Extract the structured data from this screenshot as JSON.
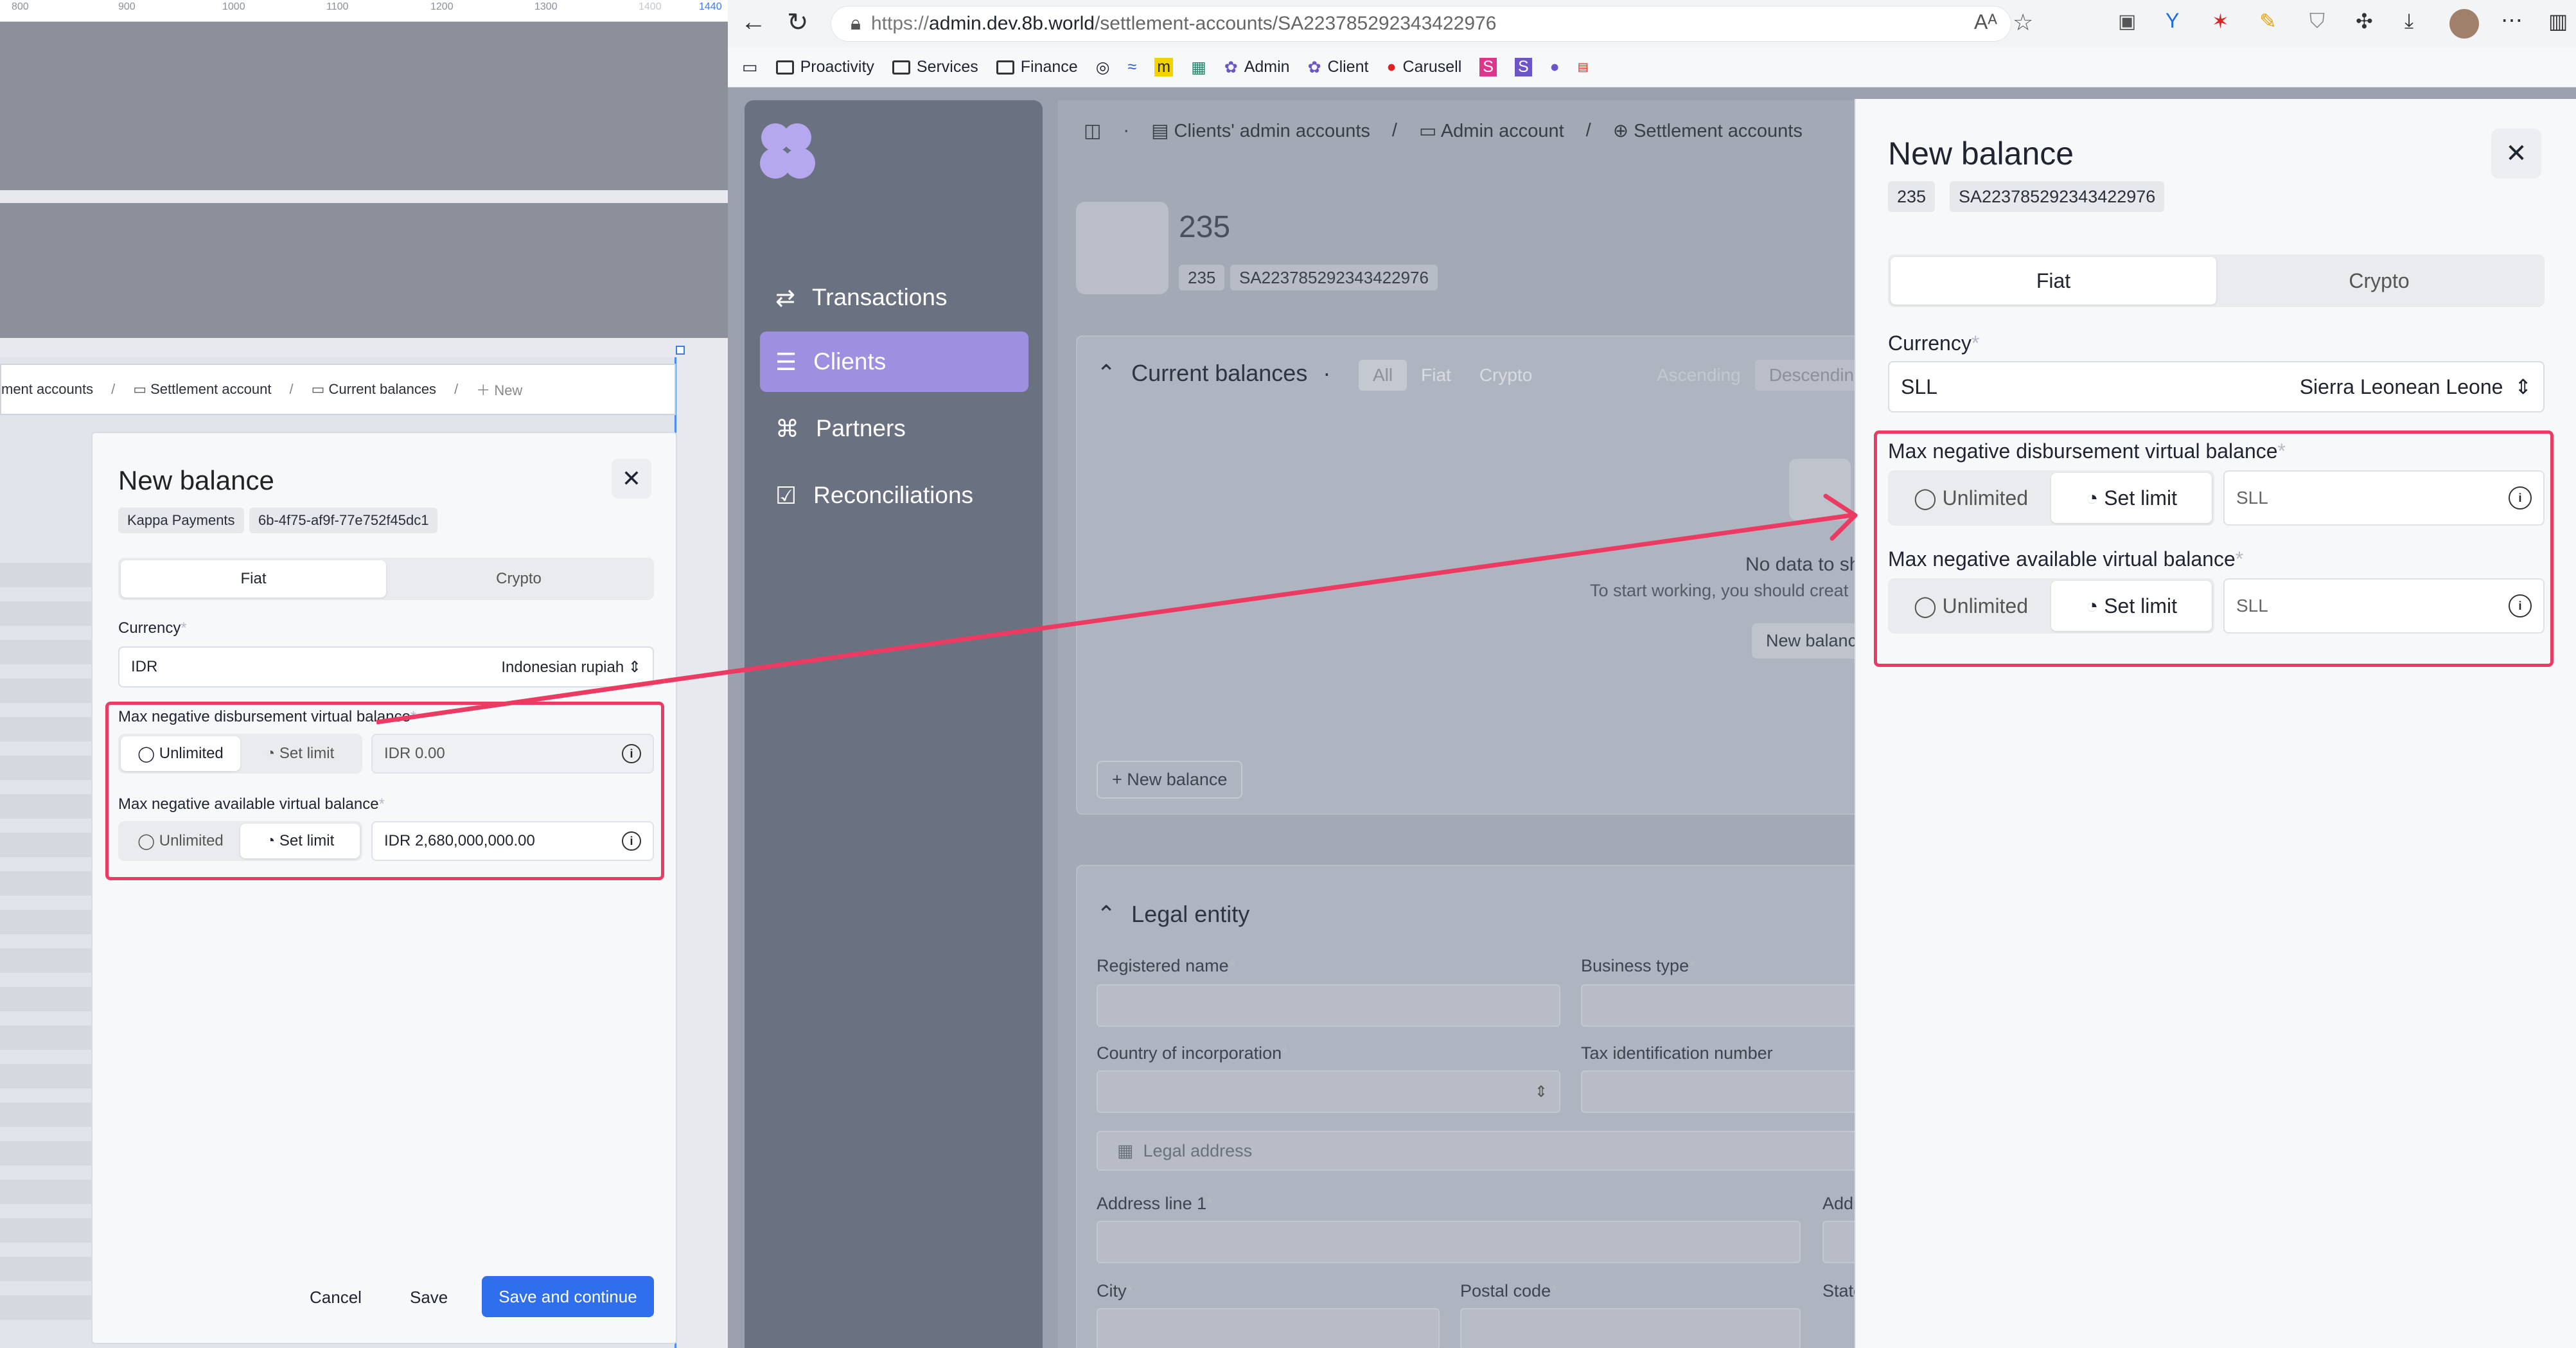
{
  "figma": {
    "ruler_ticks": [
      "800",
      "900",
      "1000",
      "1100",
      "1200",
      "1300",
      "1400",
      "1440"
    ],
    "breadcrumb": [
      "ment accounts",
      "Settlement account",
      "Current balances",
      "New"
    ],
    "modal": {
      "title": "New balance",
      "chip1": "Kappa Payments",
      "chip2": "6b-4f75-af9f-77e752f45dc1",
      "tab_fiat": "Fiat",
      "tab_crypto": "Crypto",
      "currency_label": "Currency",
      "currency_code": "IDR",
      "currency_name": "Indonesian rupiah",
      "disb_label": "Max negative disbursement virtual balance",
      "unlimited": "Unlimited",
      "set_limit": "Set limit",
      "disb_value": "IDR  0.00",
      "avail_label": "Max negative available virtual balance",
      "avail_value": "IDR  2,680,000,000.00",
      "cancel": "Cancel",
      "save": "Save",
      "save_continue": "Save and continue"
    }
  },
  "browser": {
    "url_prefix": "https://",
    "url_host": "admin.dev.8b.world",
    "url_path": "/settlement-accounts/SA223785292343422976",
    "bookmarks": [
      "Proactivity",
      "Services",
      "Finance",
      "Admin",
      "Client",
      "Carusell"
    ]
  },
  "sidebar": {
    "items": [
      "Transactions",
      "Clients",
      "Partners",
      "Reconciliations"
    ]
  },
  "main": {
    "crumbs": [
      "Clients' admin accounts",
      "Admin account",
      "Settlement accounts"
    ],
    "title": "235",
    "chip1": "235",
    "chip2": "SA223785292343422976",
    "balances_title": "Current balances",
    "filters": [
      "All",
      "Fiat",
      "Crypto",
      "Ascending",
      "Descending"
    ],
    "empty_title": "No data to sh",
    "empty_sub": "To start working, you should creat",
    "new_balance_btn": "New balanc",
    "new_balance_link": "+ New balance",
    "legal_title": "Legal entity",
    "registered_name": "Registered name",
    "business_type": "Business type",
    "country": "Country of incorporation",
    "tax_id": "Tax identification number",
    "legal_address": "Legal address",
    "address_line": "Address line 1",
    "addr_cut": "Addr",
    "city": "City",
    "postal": "Postal code",
    "state_cut": "State"
  },
  "drawer": {
    "title": "New balance",
    "chip1": "235",
    "chip2": "SA223785292343422976",
    "tab_fiat": "Fiat",
    "tab_crypto": "Crypto",
    "currency_label": "Currency",
    "currency_code": "SLL",
    "currency_name": "Sierra Leonean Leone",
    "disb_label": "Max negative disbursement virtual balance",
    "unlimited": "Unlimited",
    "set_limit": "Set limit",
    "disb_value": "SLL",
    "avail_label": "Max negative available virtual balance",
    "avail_value": "SLL"
  },
  "colors": {
    "accent": "#2f6fed",
    "highlight": "#ec3b63",
    "nav_active": "#9e8fe0"
  }
}
